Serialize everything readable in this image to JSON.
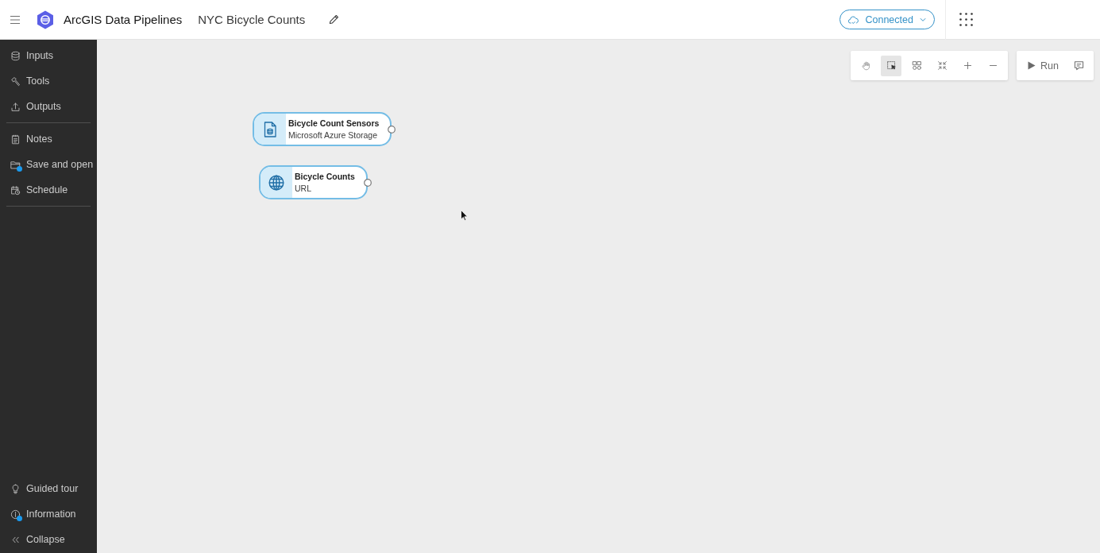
{
  "header": {
    "app_title": "ArcGIS Data Pipelines",
    "pipeline_name": "NYC Bicycle Counts",
    "connection": {
      "label": "Connected"
    }
  },
  "sidebar": {
    "groups": [
      {
        "items": [
          {
            "kind": "inputs",
            "label": "Inputs",
            "badge": false
          },
          {
            "kind": "tools",
            "label": "Tools",
            "badge": false
          },
          {
            "kind": "outputs",
            "label": "Outputs",
            "badge": false
          }
        ]
      },
      {
        "items": [
          {
            "kind": "notes",
            "label": "Notes",
            "badge": false
          },
          {
            "kind": "save",
            "label": "Save and open",
            "badge": true
          },
          {
            "kind": "schedule",
            "label": "Schedule",
            "badge": false
          }
        ]
      }
    ],
    "footer_items": [
      {
        "kind": "tour",
        "label": "Guided tour",
        "badge": false
      },
      {
        "kind": "info",
        "label": "Information",
        "badge": true
      },
      {
        "kind": "collapse",
        "label": "Collapse",
        "badge": false
      }
    ]
  },
  "toolbar": {
    "tools": [
      {
        "kind": "pan",
        "selected": false
      },
      {
        "kind": "select",
        "selected": true
      },
      {
        "kind": "arrange",
        "selected": false
      },
      {
        "kind": "fit",
        "selected": false
      },
      {
        "kind": "zoom_in",
        "selected": false
      },
      {
        "kind": "zoom_out",
        "selected": false
      }
    ],
    "run": {
      "label": "Run"
    }
  },
  "canvas": {
    "nodes": [
      {
        "kind": "file",
        "title": "Bicycle Count Sensors",
        "subtitle": "Microsoft Azure Storage"
      },
      {
        "kind": "url",
        "title": "Bicycle Counts",
        "subtitle": "URL"
      }
    ]
  }
}
